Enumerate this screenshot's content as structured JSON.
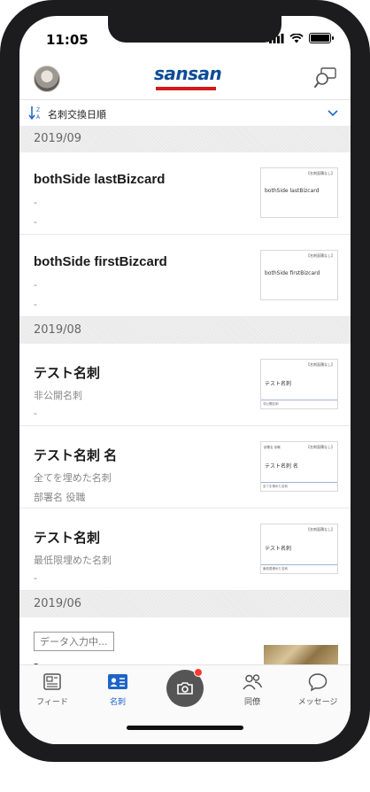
{
  "status_bar": {
    "time": "11:05"
  },
  "header": {
    "logo_text": "sansan"
  },
  "sort": {
    "label": "名刺交換日順"
  },
  "sections": [
    {
      "date": "2019/09",
      "cards": [
        {
          "name": "bothSide lastBizcard",
          "line1": "-",
          "line2": "-",
          "thumb_name": "bothSide lastBizcard",
          "thumb_tag": "【名刺面積なし】",
          "thumb_sub": "",
          "thumb_dept": ""
        },
        {
          "name": "bothSide firstBizcard",
          "line1": "-",
          "line2": "-",
          "thumb_name": "bothSide firstBizcard",
          "thumb_tag": "【名刺面積なし】",
          "thumb_sub": "",
          "thumb_dept": ""
        }
      ]
    },
    {
      "date": "2019/08",
      "cards": [
        {
          "name": "テスト名刺",
          "line1": "非公開名刺",
          "line2": "-",
          "thumb_name": "テスト名刺",
          "thumb_tag": "【名刺面積なし】",
          "thumb_sub": "非公開名刺",
          "thumb_dept": ""
        },
        {
          "name": "テスト名刺 名",
          "line1": "全てを埋めた名刺",
          "line2": "部署名 役職",
          "thumb_name": "テスト名刺 名",
          "thumb_tag": "【名刺面積なし】",
          "thumb_sub": "全てを埋めた名刺",
          "thumb_dept": "部署名 役職"
        },
        {
          "name": "テスト名刺",
          "line1": "最低限埋めた名刺",
          "line2": "-",
          "thumb_name": "テスト名刺",
          "thumb_tag": "【名刺面積なし】",
          "thumb_sub": "最低限埋めた名刺",
          "thumb_dept": ""
        }
      ]
    },
    {
      "date": "2019/06",
      "pending": {
        "badge": "データ入力中...",
        "name": "-"
      }
    }
  ],
  "tabs": [
    {
      "label": "フィード",
      "icon": "feed-icon",
      "active": false
    },
    {
      "label": "名刺",
      "icon": "business-card-icon",
      "active": true
    },
    {
      "label": "",
      "icon": "camera-icon",
      "active": false
    },
    {
      "label": "同僚",
      "icon": "colleagues-icon",
      "active": false
    },
    {
      "label": "メッセージ",
      "icon": "message-icon",
      "active": false
    }
  ],
  "colors": {
    "brand_blue": "#0b4c97",
    "brand_red": "#d21a1a",
    "active_tab": "#1e64c8",
    "notification": "#ff3b30"
  }
}
